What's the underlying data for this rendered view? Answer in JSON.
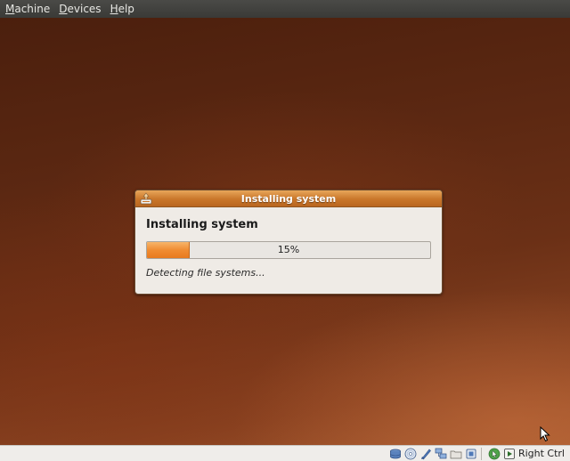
{
  "menubar": {
    "items": [
      {
        "label": "Machine",
        "mnemonic": "M",
        "rest": "achine"
      },
      {
        "label": "Devices",
        "mnemonic": "D",
        "rest": "evices"
      },
      {
        "label": "Help",
        "mnemonic": "H",
        "rest": "elp"
      }
    ]
  },
  "dialog": {
    "window_title": "Installing system",
    "heading": "Installing system",
    "progress": {
      "value": 15,
      "label": "15%"
    },
    "status_text": "Detecting file systems..."
  },
  "statusbar": {
    "icons": [
      "hard-disk-icon",
      "cd-icon",
      "floppy-icon",
      "network-icon",
      "shared-folders-icon",
      "usb-icon",
      "mouse-integration-icon",
      "host-key-icon"
    ],
    "host_key": "Right Ctrl"
  },
  "colors": {
    "accent": "#e8842a",
    "titlebar": "#c9762a",
    "dialog_bg": "#efebe6"
  }
}
